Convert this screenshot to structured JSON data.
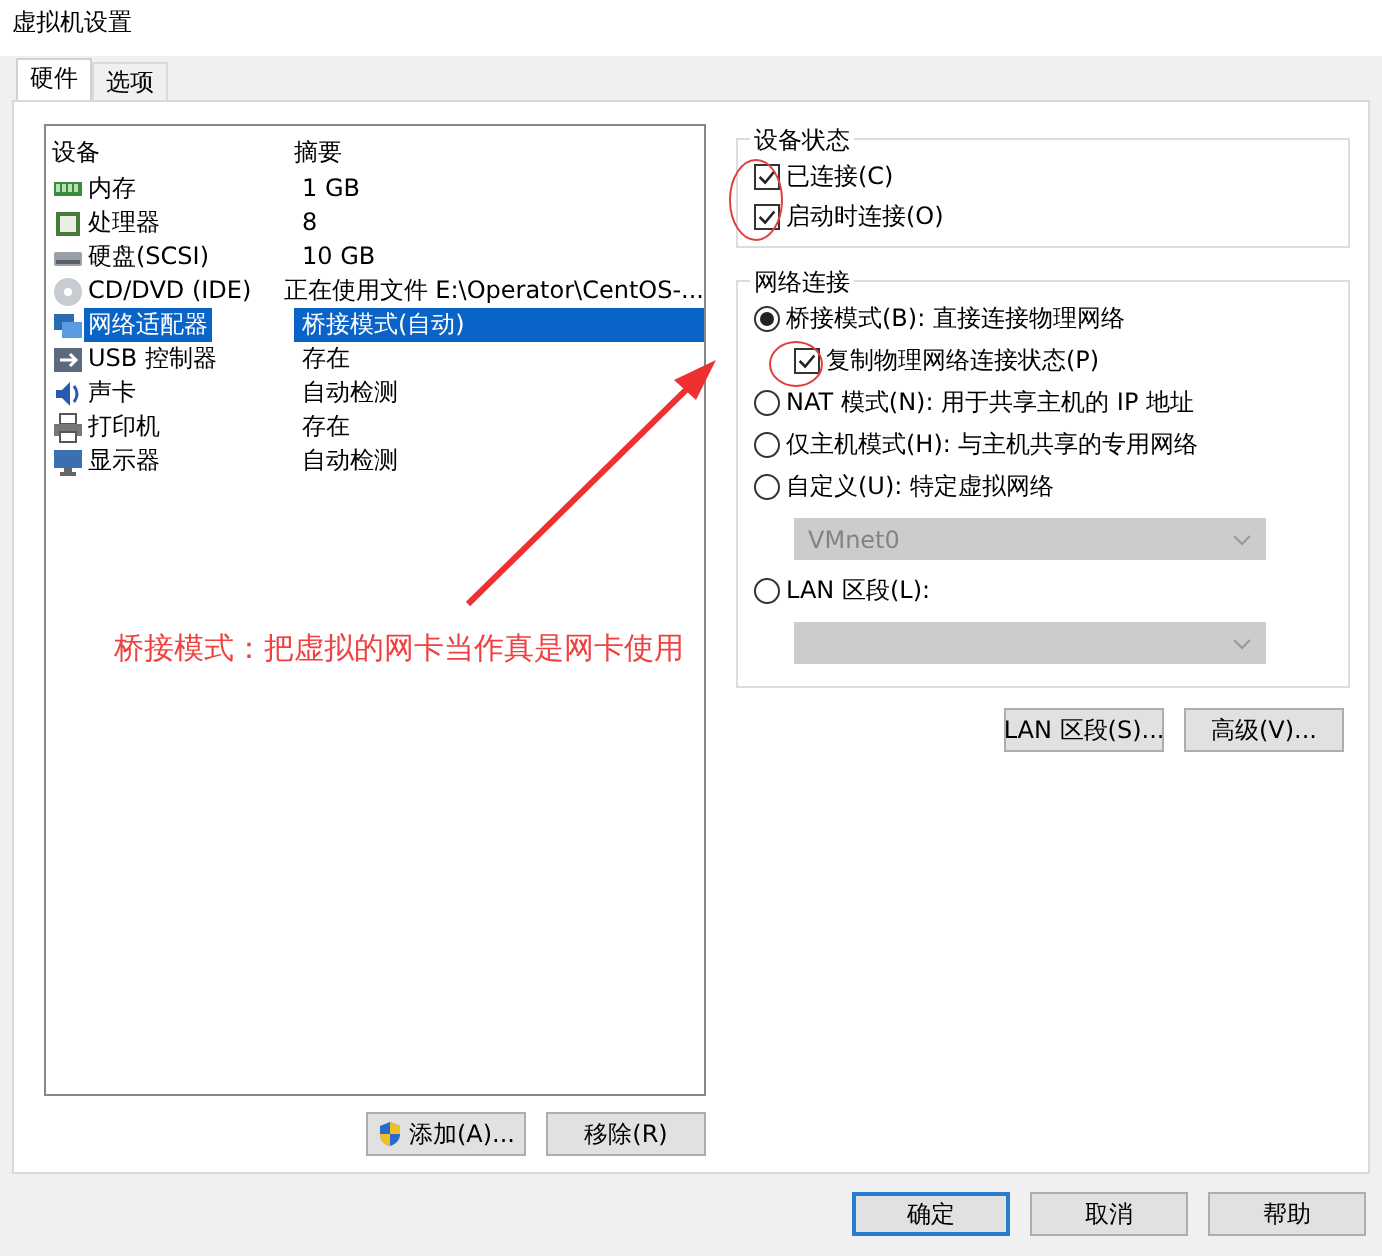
{
  "window": {
    "title": "虚拟机设置"
  },
  "tabs": [
    {
      "label": "硬件",
      "selected": true
    },
    {
      "label": "选项",
      "selected": false
    }
  ],
  "devices": {
    "columns": [
      "设备",
      "摘要"
    ],
    "rows": [
      {
        "kind": "memory",
        "device": "内存",
        "summary": "1 GB",
        "selected": false
      },
      {
        "kind": "cpu",
        "device": "处理器",
        "summary": "8",
        "selected": false
      },
      {
        "kind": "disk",
        "device": "硬盘(SCSI)",
        "summary": "10 GB",
        "selected": false
      },
      {
        "kind": "cdrom",
        "device": "CD/DVD (IDE)",
        "summary": "正在使用文件 E:\\Operator\\CentOS-...",
        "selected": false
      },
      {
        "kind": "network",
        "device": "网络适配器",
        "summary": "桥接模式(自动)",
        "selected": true
      },
      {
        "kind": "usb",
        "device": "USB 控制器",
        "summary": "存在",
        "selected": false
      },
      {
        "kind": "sound",
        "device": "声卡",
        "summary": "自动检测",
        "selected": false
      },
      {
        "kind": "printer",
        "device": "打印机",
        "summary": "存在",
        "selected": false
      },
      {
        "kind": "display",
        "device": "显示器",
        "summary": "自动检测",
        "selected": false
      }
    ]
  },
  "list_buttons": [
    {
      "kind": "shield",
      "label": "添加(A)..."
    },
    {
      "kind": "plain",
      "label": "移除(R)"
    }
  ],
  "device_status": {
    "title": "设备状态",
    "items": [
      {
        "label": "已连接(C)",
        "checked": true
      },
      {
        "label": "启动时连接(O)",
        "checked": true
      }
    ]
  },
  "network": {
    "title": "网络连接",
    "options": [
      {
        "kind": "radio",
        "label": "桥接模式(B): 直接连接物理网络",
        "selected": true
      },
      {
        "kind": "checkbox",
        "label": "复制物理网络连接状态(P)",
        "checked": true
      },
      {
        "kind": "radio",
        "label": "NAT 模式(N): 用于共享主机的 IP 地址",
        "selected": false
      },
      {
        "kind": "radio",
        "label": "仅主机模式(H): 与主机共享的专用网络",
        "selected": false
      },
      {
        "kind": "radio",
        "label": "自定义(U): 特定虚拟网络",
        "selected": false
      },
      {
        "kind": "dropdown",
        "value": "VMnet0",
        "disabled": true
      },
      {
        "kind": "radio",
        "label": "LAN 区段(L):",
        "selected": false
      },
      {
        "kind": "dropdown",
        "disabled": true
      }
    ]
  },
  "network_buttons": [
    "LAN 区段(S)...",
    "高级(V)..."
  ],
  "annotation": "桥接模式：把虚拟的网卡当作真是网卡使用",
  "dialog_buttons": [
    {
      "label": "确定",
      "default": true
    },
    {
      "label": "取消",
      "default": false
    },
    {
      "label": "帮助",
      "default": false
    }
  ]
}
